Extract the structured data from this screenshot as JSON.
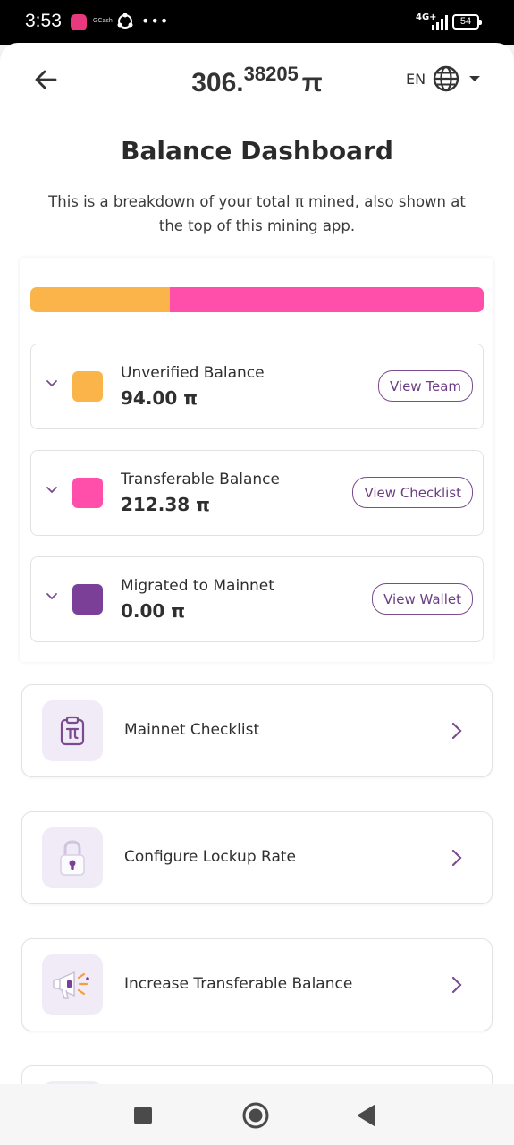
{
  "status_bar": {
    "time": "3:53",
    "app_label": "GCash",
    "more": "•••",
    "network": "4G+",
    "battery": "54"
  },
  "header": {
    "balance_int": "306.",
    "balance_dec": "38205",
    "currency": "π",
    "language": "EN"
  },
  "page": {
    "title": "Balance Dashboard",
    "description": "This is a breakdown of your total π mined, also shown at the top of this mining app."
  },
  "progress": [
    {
      "name": "unverified",
      "fraction": 0.307,
      "color": "#FBB44A"
    },
    {
      "name": "transferable",
      "fraction": 0.693,
      "color": "#FF4FAB"
    }
  ],
  "balances": [
    {
      "label": "Unverified Balance",
      "value": "94.00 π",
      "button": "View Team",
      "color": "#FBB44A"
    },
    {
      "label": "Transferable Balance",
      "value": "212.38 π",
      "button": "View Checklist",
      "color": "#FF4FAB"
    },
    {
      "label": "Migrated to Mainnet",
      "value": "0.00 π",
      "button": "View Wallet",
      "color": "#7B3F98"
    }
  ],
  "actions": [
    {
      "label": "Mainnet Checklist",
      "icon": "clipboard-pi-icon"
    },
    {
      "label": "Configure Lockup Rate",
      "icon": "padlock-icon"
    },
    {
      "label": "Increase Transferable Balance",
      "icon": "megaphone-icon"
    }
  ],
  "colors": {
    "accent": "#6B3D82",
    "icon_bg": "#F1EBF8"
  }
}
